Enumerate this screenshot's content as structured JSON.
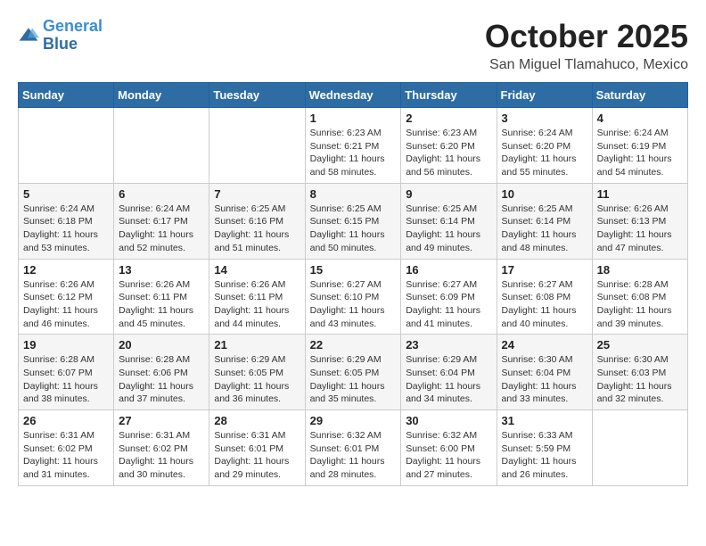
{
  "logo": {
    "line1": "General",
    "line2": "Blue"
  },
  "title": "October 2025",
  "subtitle": "San Miguel Tlamahuco, Mexico",
  "weekdays": [
    "Sunday",
    "Monday",
    "Tuesday",
    "Wednesday",
    "Thursday",
    "Friday",
    "Saturday"
  ],
  "weeks": [
    [
      {
        "day": "",
        "info": ""
      },
      {
        "day": "",
        "info": ""
      },
      {
        "day": "",
        "info": ""
      },
      {
        "day": "1",
        "info": "Sunrise: 6:23 AM\nSunset: 6:21 PM\nDaylight: 11 hours and 58 minutes."
      },
      {
        "day": "2",
        "info": "Sunrise: 6:23 AM\nSunset: 6:20 PM\nDaylight: 11 hours and 56 minutes."
      },
      {
        "day": "3",
        "info": "Sunrise: 6:24 AM\nSunset: 6:20 PM\nDaylight: 11 hours and 55 minutes."
      },
      {
        "day": "4",
        "info": "Sunrise: 6:24 AM\nSunset: 6:19 PM\nDaylight: 11 hours and 54 minutes."
      }
    ],
    [
      {
        "day": "5",
        "info": "Sunrise: 6:24 AM\nSunset: 6:18 PM\nDaylight: 11 hours and 53 minutes."
      },
      {
        "day": "6",
        "info": "Sunrise: 6:24 AM\nSunset: 6:17 PM\nDaylight: 11 hours and 52 minutes."
      },
      {
        "day": "7",
        "info": "Sunrise: 6:25 AM\nSunset: 6:16 PM\nDaylight: 11 hours and 51 minutes."
      },
      {
        "day": "8",
        "info": "Sunrise: 6:25 AM\nSunset: 6:15 PM\nDaylight: 11 hours and 50 minutes."
      },
      {
        "day": "9",
        "info": "Sunrise: 6:25 AM\nSunset: 6:14 PM\nDaylight: 11 hours and 49 minutes."
      },
      {
        "day": "10",
        "info": "Sunrise: 6:25 AM\nSunset: 6:14 PM\nDaylight: 11 hours and 48 minutes."
      },
      {
        "day": "11",
        "info": "Sunrise: 6:26 AM\nSunset: 6:13 PM\nDaylight: 11 hours and 47 minutes."
      }
    ],
    [
      {
        "day": "12",
        "info": "Sunrise: 6:26 AM\nSunset: 6:12 PM\nDaylight: 11 hours and 46 minutes."
      },
      {
        "day": "13",
        "info": "Sunrise: 6:26 AM\nSunset: 6:11 PM\nDaylight: 11 hours and 45 minutes."
      },
      {
        "day": "14",
        "info": "Sunrise: 6:26 AM\nSunset: 6:11 PM\nDaylight: 11 hours and 44 minutes."
      },
      {
        "day": "15",
        "info": "Sunrise: 6:27 AM\nSunset: 6:10 PM\nDaylight: 11 hours and 43 minutes."
      },
      {
        "day": "16",
        "info": "Sunrise: 6:27 AM\nSunset: 6:09 PM\nDaylight: 11 hours and 41 minutes."
      },
      {
        "day": "17",
        "info": "Sunrise: 6:27 AM\nSunset: 6:08 PM\nDaylight: 11 hours and 40 minutes."
      },
      {
        "day": "18",
        "info": "Sunrise: 6:28 AM\nSunset: 6:08 PM\nDaylight: 11 hours and 39 minutes."
      }
    ],
    [
      {
        "day": "19",
        "info": "Sunrise: 6:28 AM\nSunset: 6:07 PM\nDaylight: 11 hours and 38 minutes."
      },
      {
        "day": "20",
        "info": "Sunrise: 6:28 AM\nSunset: 6:06 PM\nDaylight: 11 hours and 37 minutes."
      },
      {
        "day": "21",
        "info": "Sunrise: 6:29 AM\nSunset: 6:05 PM\nDaylight: 11 hours and 36 minutes."
      },
      {
        "day": "22",
        "info": "Sunrise: 6:29 AM\nSunset: 6:05 PM\nDaylight: 11 hours and 35 minutes."
      },
      {
        "day": "23",
        "info": "Sunrise: 6:29 AM\nSunset: 6:04 PM\nDaylight: 11 hours and 34 minutes."
      },
      {
        "day": "24",
        "info": "Sunrise: 6:30 AM\nSunset: 6:04 PM\nDaylight: 11 hours and 33 minutes."
      },
      {
        "day": "25",
        "info": "Sunrise: 6:30 AM\nSunset: 6:03 PM\nDaylight: 11 hours and 32 minutes."
      }
    ],
    [
      {
        "day": "26",
        "info": "Sunrise: 6:31 AM\nSunset: 6:02 PM\nDaylight: 11 hours and 31 minutes."
      },
      {
        "day": "27",
        "info": "Sunrise: 6:31 AM\nSunset: 6:02 PM\nDaylight: 11 hours and 30 minutes."
      },
      {
        "day": "28",
        "info": "Sunrise: 6:31 AM\nSunset: 6:01 PM\nDaylight: 11 hours and 29 minutes."
      },
      {
        "day": "29",
        "info": "Sunrise: 6:32 AM\nSunset: 6:01 PM\nDaylight: 11 hours and 28 minutes."
      },
      {
        "day": "30",
        "info": "Sunrise: 6:32 AM\nSunset: 6:00 PM\nDaylight: 11 hours and 27 minutes."
      },
      {
        "day": "31",
        "info": "Sunrise: 6:33 AM\nSunset: 5:59 PM\nDaylight: 11 hours and 26 minutes."
      },
      {
        "day": "",
        "info": ""
      }
    ]
  ]
}
